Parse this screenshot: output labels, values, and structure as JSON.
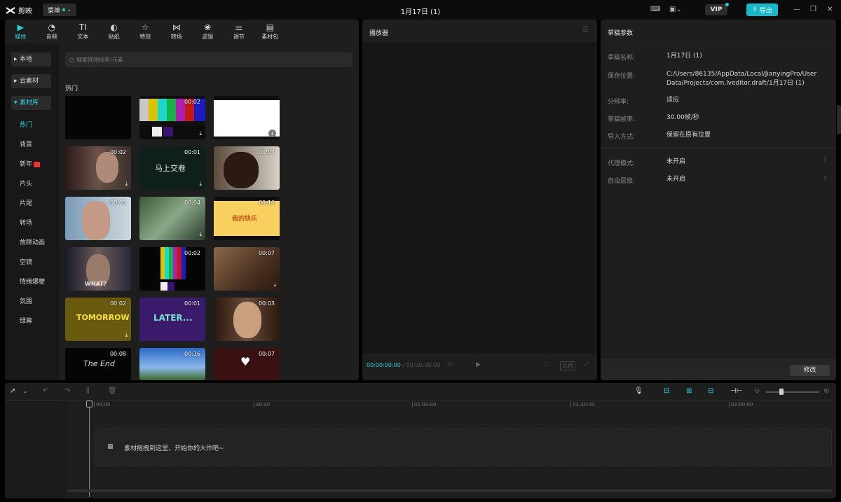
{
  "app": {
    "logo_text": "剪映",
    "menu_label": "菜单",
    "window_title": "1月17日 (1)",
    "vip_label": "VIP",
    "export_label": "导出"
  },
  "tabs": [
    {
      "label": "媒体",
      "icon": "media-icon",
      "active": true
    },
    {
      "label": "音频",
      "icon": "audio-icon"
    },
    {
      "label": "文本",
      "icon": "text-icon"
    },
    {
      "label": "贴纸",
      "icon": "sticker-icon"
    },
    {
      "label": "特效",
      "icon": "effects-icon"
    },
    {
      "label": "转场",
      "icon": "transition-icon"
    },
    {
      "label": "滤镜",
      "icon": "filter-icon"
    },
    {
      "label": "调节",
      "icon": "adjust-icon"
    },
    {
      "label": "素材包",
      "icon": "package-icon"
    }
  ],
  "sidebar": {
    "sections": [
      "本地",
      "云素材",
      "素材库"
    ],
    "items": [
      "热门",
      "背景",
      "新年",
      "片头",
      "片尾",
      "转场",
      "故障动画",
      "空镜",
      "情绪爆梗",
      "氛围",
      "绿幕"
    ]
  },
  "search": {
    "placeholder": "搜索视频场景/元素"
  },
  "media": {
    "section_title": "热门",
    "thumbs": [
      {
        "duration": "",
        "download": false
      },
      {
        "duration": "00:02",
        "download": true
      },
      {
        "duration": "",
        "download": true
      },
      {
        "duration": "00:02",
        "download": true
      },
      {
        "duration": "00:01",
        "download": true,
        "caption": "马上交卷"
      },
      {
        "duration": "00:03",
        "download": false
      },
      {
        "duration": "00:03",
        "download": false
      },
      {
        "duration": "00:04",
        "download": true
      },
      {
        "duration": "00:16",
        "download": false,
        "caption": "我的快乐"
      },
      {
        "duration": "",
        "download": false,
        "caption": "WHAT?"
      },
      {
        "duration": "00:02",
        "download": false
      },
      {
        "duration": "00:07",
        "download": true
      },
      {
        "duration": "00:02",
        "download": true,
        "caption": "TOMORROW"
      },
      {
        "duration": "00:01",
        "download": false,
        "caption": "LATER..."
      },
      {
        "duration": "00:03",
        "download": false
      },
      {
        "duration": "00:08",
        "download": false,
        "caption": "The End"
      },
      {
        "duration": "00:16",
        "download": false
      },
      {
        "duration": "00:07",
        "download": false
      }
    ]
  },
  "player": {
    "title": "播放器",
    "current_time": "00:00:00:00",
    "total_time": "00:00:00:00",
    "ratio_label": "比例"
  },
  "properties": {
    "title": "草稿参数",
    "rows": [
      {
        "label": "草稿名称:",
        "value": "1月17日 (1)"
      },
      {
        "label": "保存位置:",
        "value": "C:/Users/86135/AppData/Local/JianyingPro/User Data/Projects/com.lveditor.draft/1月17日 (1)"
      },
      {
        "label": "分辨率:",
        "value": "适应"
      },
      {
        "label": "草稿帧率:",
        "value": "30.00帧/秒"
      },
      {
        "label": "导入方式:",
        "value": "保留在原有位置"
      },
      {
        "label": "代理模式:",
        "value": "未开启"
      },
      {
        "label": "自由层级:",
        "value": "未开启"
      }
    ],
    "modify_label": "修改"
  },
  "timeline": {
    "ticks": [
      "00:00",
      "30:00",
      "01:00:00",
      "01:30:00",
      "02:00:00"
    ],
    "drop_hint": "素材拖拽到这里，开始你的大作吧~"
  }
}
